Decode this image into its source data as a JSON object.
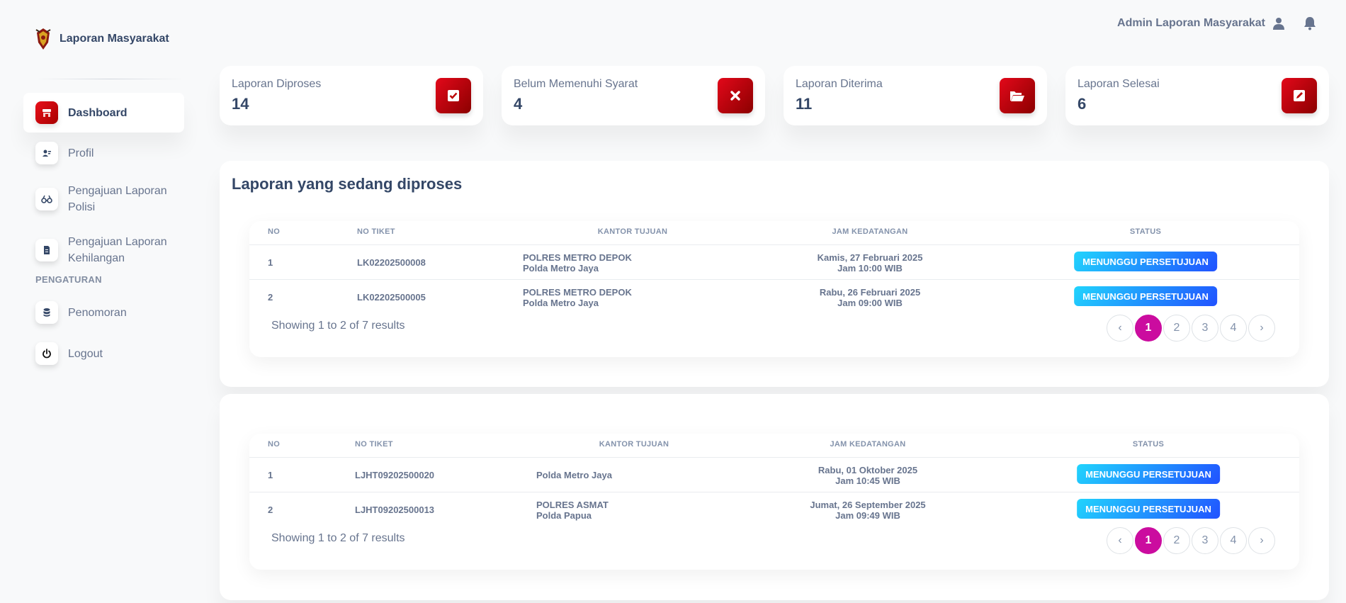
{
  "brand": {
    "name": "Laporan Masyarakat"
  },
  "sidebar": {
    "items": [
      {
        "label": "Dashboard",
        "icon": "shop-icon"
      },
      {
        "label": "Profil",
        "icon": "user-card-icon"
      },
      {
        "label": "Pengajuan Laporan Polisi",
        "icon": "glasses-icon"
      },
      {
        "label": "Pengajuan Laporan Kehilangan",
        "icon": "document-icon"
      }
    ],
    "section": "PENGATURAN",
    "settings_items": [
      {
        "label": "Penomoran",
        "icon": "database-icon"
      },
      {
        "label": "Logout",
        "icon": "power-icon"
      }
    ]
  },
  "topbar": {
    "user": "Admin Laporan Masyarakat"
  },
  "stats": [
    {
      "label": "Laporan Diproses",
      "value": "14",
      "icon": "check-square-icon"
    },
    {
      "label": "Belum Memenuhi Syarat",
      "value": "4",
      "icon": "x-icon"
    },
    {
      "label": "Laporan Diterima",
      "value": "11",
      "icon": "folder-open-icon"
    },
    {
      "label": "Laporan Selesai",
      "value": "6",
      "icon": "edit-icon"
    }
  ],
  "panel1": {
    "title": "Laporan yang sedang diproses",
    "headers": [
      "NO",
      "NO TIKET",
      "KANTOR TUJUAN",
      "JAM KEDATANGAN",
      "STATUS"
    ],
    "rows": [
      {
        "no": "1",
        "ticket": "LK02202500008",
        "office1": "POLRES METRO DEPOK",
        "office2": "Polda Metro Jaya",
        "date": "Kamis, 27 Februari 2025",
        "time": "Jam 10:00 WIB",
        "status": "MENUNGGU PERSETUJUAN"
      },
      {
        "no": "2",
        "ticket": "LK02202500005",
        "office1": "POLRES METRO DEPOK",
        "office2": "Polda Metro Jaya",
        "date": "Rabu, 26 Februari 2025",
        "time": "Jam 09:00 WIB",
        "status": "MENUNGGU PERSETUJUAN"
      }
    ],
    "showing": "Showing 1 to 2 of 7 results",
    "pages": [
      "‹",
      "1",
      "2",
      "3",
      "4",
      "›"
    ],
    "current_page": "1"
  },
  "panel2": {
    "headers": [
      "NO",
      "NO TIKET",
      "KANTOR TUJUAN",
      "JAM KEDATANGAN",
      "STATUS"
    ],
    "rows": [
      {
        "no": "1",
        "ticket": "LJHT09202500020",
        "office1": "Polda Metro Jaya",
        "office2": "",
        "date": "Rabu, 01 Oktober 2025",
        "time": "Jam 10:45 WIB",
        "status": "MENUNGGU PERSETUJUAN"
      },
      {
        "no": "2",
        "ticket": "LJHT09202500013",
        "office1": "POLRES ASMAT",
        "office2": "Polda Papua",
        "date": "Jumat, 26 September 2025",
        "time": "Jam 09:49 WIB",
        "status": "MENUNGGU PERSETUJUAN"
      }
    ],
    "showing": "Showing 1 to 2 of 7 results",
    "pages": [
      "‹",
      "1",
      "2",
      "3",
      "4",
      "›"
    ],
    "current_page": "1"
  },
  "colors": {
    "primary": "#cb0c9f",
    "danger": "#e3081a",
    "info": "#2152ff",
    "text": "#344767",
    "muted": "#67748e"
  }
}
